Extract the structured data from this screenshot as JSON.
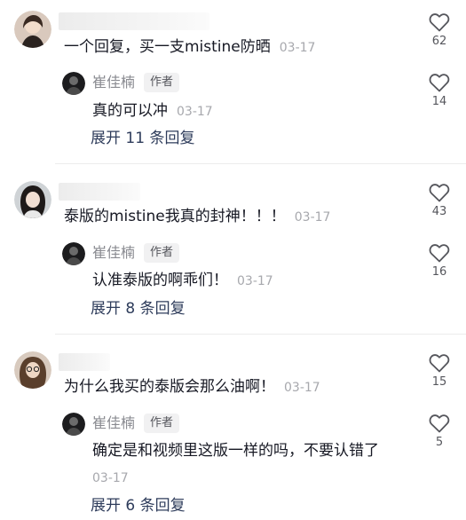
{
  "threads": [
    {
      "comment": {
        "text": "一个回复，买一支mistine防晒",
        "time": "03-17",
        "likes": "62"
      },
      "reply": {
        "author": "崔佳楠",
        "badge": "作者",
        "text": "真的可以冲",
        "time": "03-17",
        "likes": "14"
      },
      "expand": "展开 11 条回复"
    },
    {
      "comment": {
        "text": "泰版的mistine我真的封神！！！",
        "time": "03-17",
        "likes": "43"
      },
      "reply": {
        "author": "崔佳楠",
        "badge": "作者",
        "text": "认准泰版的啊乖们！",
        "time": "03-17",
        "likes": "16"
      },
      "expand": "展开 8 条回复"
    },
    {
      "comment": {
        "text": "为什么我买的泰版会那么油啊！",
        "time": "03-17",
        "likes": "15"
      },
      "reply": {
        "author": "崔佳楠",
        "badge": "作者",
        "text": "确定是和视频里这版一样的吗，不要认错了",
        "time": "03-17",
        "likes": "5"
      },
      "expand": "展开 6 条回复"
    }
  ],
  "colors": {
    "link": "#2e3c5b",
    "muted": "#a7a8ad",
    "text": "#161823"
  },
  "icons": {
    "like": "heart-outline-icon"
  }
}
